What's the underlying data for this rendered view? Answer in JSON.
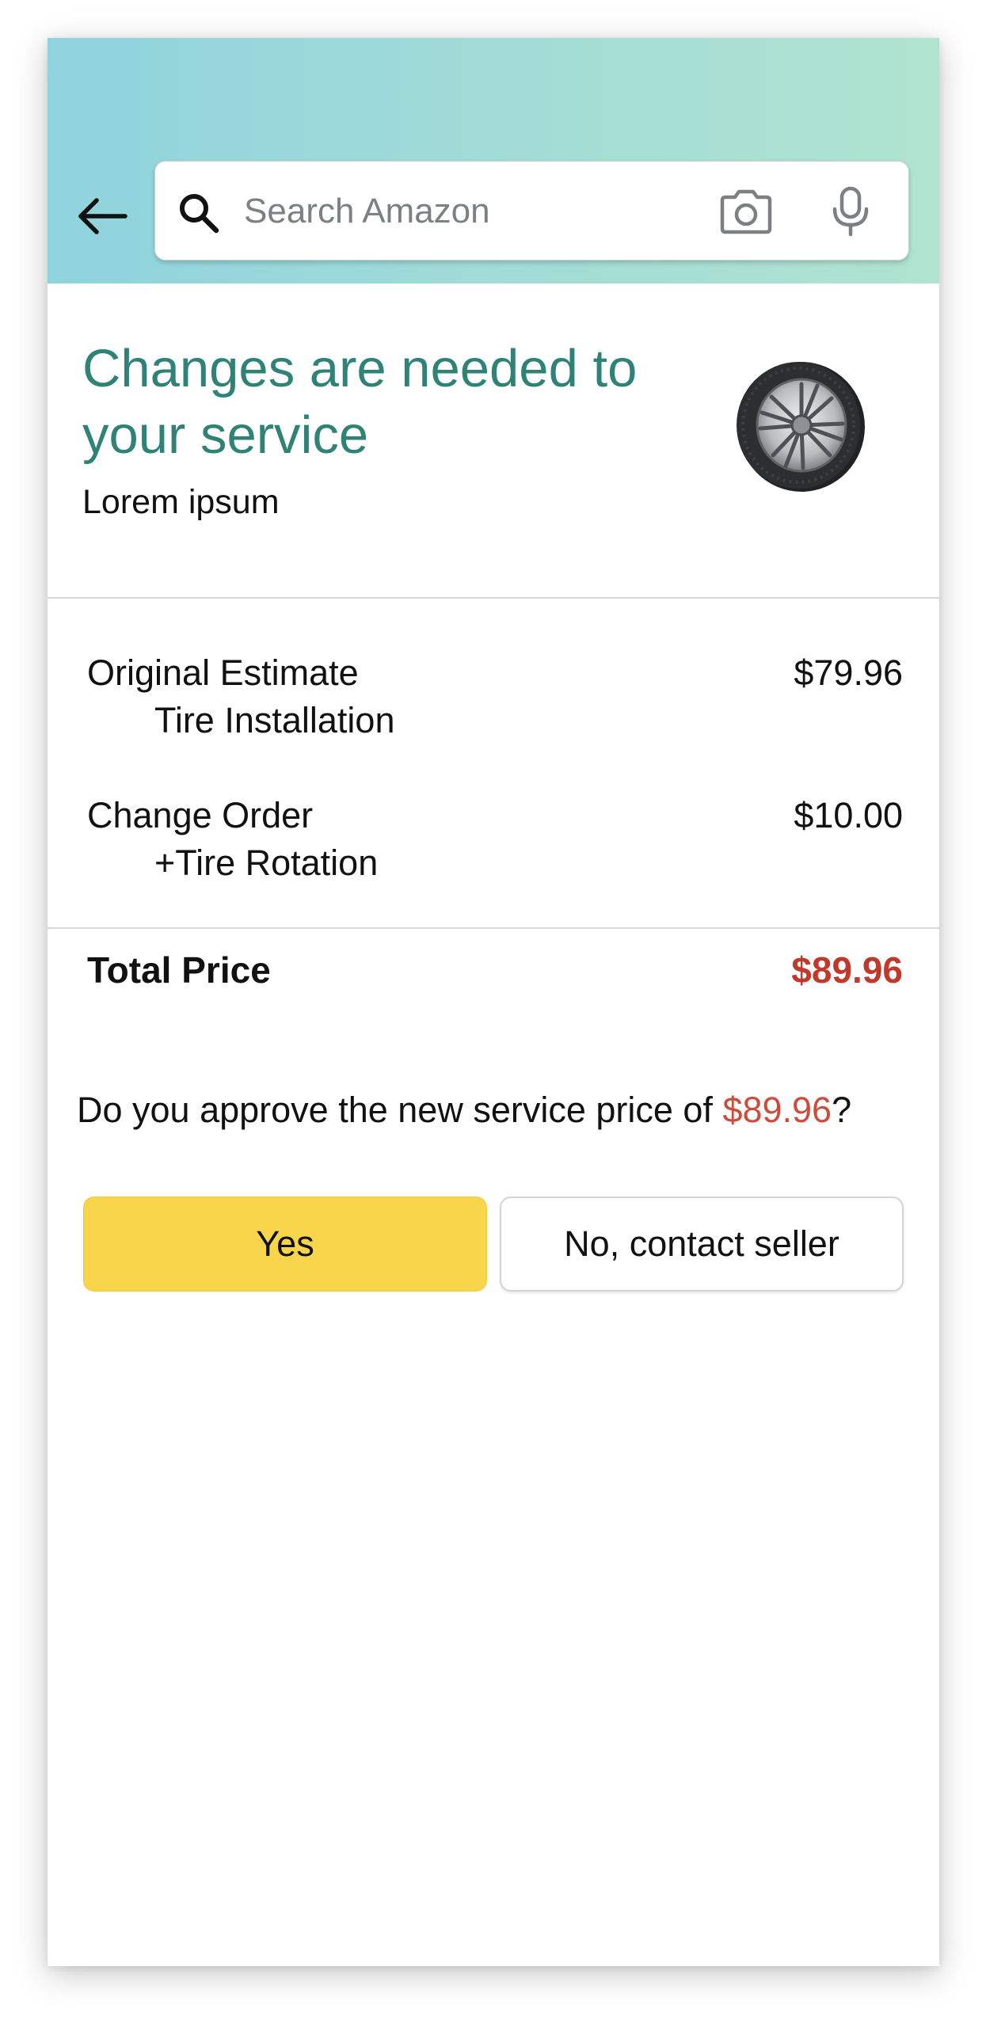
{
  "header": {
    "search": {
      "placeholder": "Search Amazon",
      "value": ""
    },
    "icons": {
      "back": "back-arrow-icon",
      "search": "search-icon",
      "camera": "camera-icon",
      "mic": "microphone-icon"
    },
    "gradient_colors": [
      "#8fd3de",
      "#b0e4d0"
    ]
  },
  "notice": {
    "title": "Changes are needed to your service",
    "subtitle": "Lorem ipsum",
    "image": "tire-image"
  },
  "line_items": [
    {
      "label": "Original Estimate",
      "detail": "Tire Installation",
      "price": "$79.96"
    },
    {
      "label": "Change Order",
      "detail": "+Tire Rotation",
      "price": "$10.00"
    }
  ],
  "total": {
    "label": "Total Price",
    "value": "$89.96"
  },
  "approval": {
    "question_prefix": "Do you approve the new service price of ",
    "question_price": "$89.96",
    "question_suffix": "?",
    "yes_label": "Yes",
    "no_label": "No, contact seller"
  },
  "colors": {
    "title": "#2f8276",
    "price_highlight": "#c0392b",
    "primary_button": "#f8d54a"
  }
}
